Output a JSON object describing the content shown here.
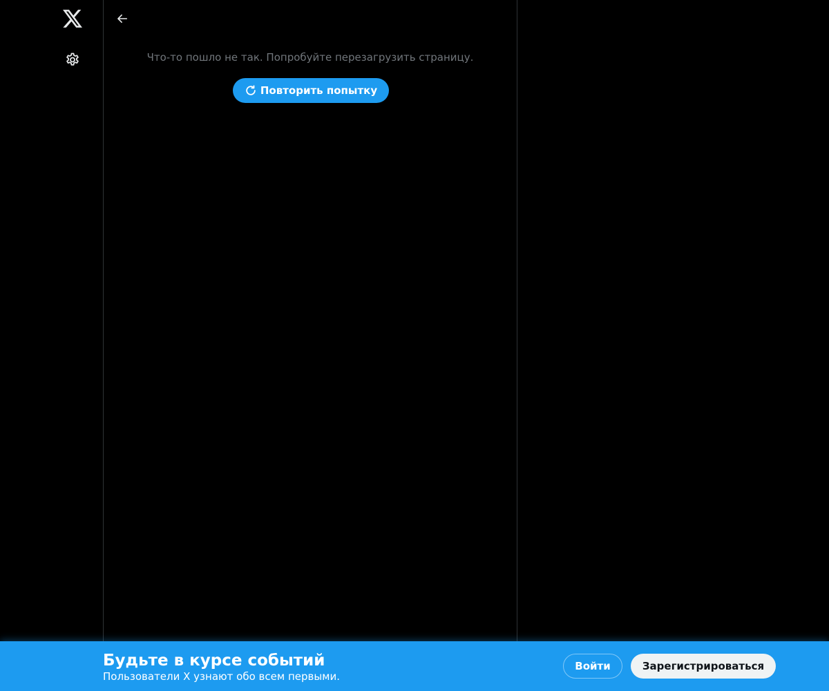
{
  "left_rail": {
    "logo_icon": "x-logo-icon",
    "settings_icon": "gear-icon"
  },
  "main": {
    "back_icon": "arrow-left-icon",
    "error_message": "Что-то пошло не так. Попробуйте перезагрузить страницу.",
    "retry_label": "Повторить попытку",
    "retry_icon": "refresh-icon"
  },
  "bottom_bar": {
    "title": "Будьте в курсе событий",
    "subtitle": "Пользователи X узнают обо всем первыми.",
    "login_label": "Войти",
    "signup_label": "Зарегистрироваться"
  },
  "colors": {
    "background": "#000000",
    "accent": "#1d9bf0",
    "muted_text": "#71767b",
    "divider": "#2f3336",
    "signup_bg": "#eff3f4"
  }
}
